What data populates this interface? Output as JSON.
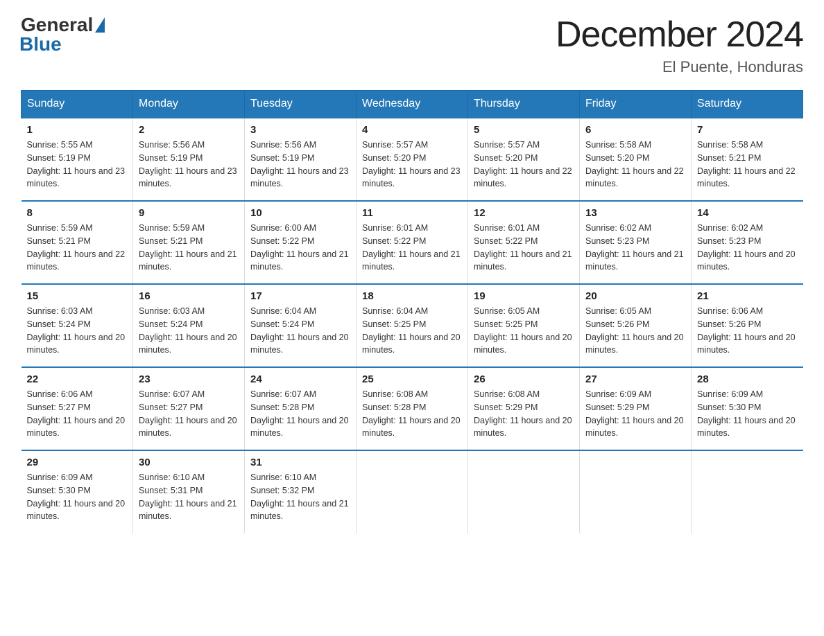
{
  "logo": {
    "general": "General",
    "blue": "Blue"
  },
  "title": "December 2024",
  "location": "El Puente, Honduras",
  "days_header": [
    "Sunday",
    "Monday",
    "Tuesday",
    "Wednesday",
    "Thursday",
    "Friday",
    "Saturday"
  ],
  "weeks": [
    [
      {
        "day": "1",
        "sunrise": "5:55 AM",
        "sunset": "5:19 PM",
        "daylight": "11 hours and 23 minutes."
      },
      {
        "day": "2",
        "sunrise": "5:56 AM",
        "sunset": "5:19 PM",
        "daylight": "11 hours and 23 minutes."
      },
      {
        "day": "3",
        "sunrise": "5:56 AM",
        "sunset": "5:19 PM",
        "daylight": "11 hours and 23 minutes."
      },
      {
        "day": "4",
        "sunrise": "5:57 AM",
        "sunset": "5:20 PM",
        "daylight": "11 hours and 23 minutes."
      },
      {
        "day": "5",
        "sunrise": "5:57 AM",
        "sunset": "5:20 PM",
        "daylight": "11 hours and 22 minutes."
      },
      {
        "day": "6",
        "sunrise": "5:58 AM",
        "sunset": "5:20 PM",
        "daylight": "11 hours and 22 minutes."
      },
      {
        "day": "7",
        "sunrise": "5:58 AM",
        "sunset": "5:21 PM",
        "daylight": "11 hours and 22 minutes."
      }
    ],
    [
      {
        "day": "8",
        "sunrise": "5:59 AM",
        "sunset": "5:21 PM",
        "daylight": "11 hours and 22 minutes."
      },
      {
        "day": "9",
        "sunrise": "5:59 AM",
        "sunset": "5:21 PM",
        "daylight": "11 hours and 21 minutes."
      },
      {
        "day": "10",
        "sunrise": "6:00 AM",
        "sunset": "5:22 PM",
        "daylight": "11 hours and 21 minutes."
      },
      {
        "day": "11",
        "sunrise": "6:01 AM",
        "sunset": "5:22 PM",
        "daylight": "11 hours and 21 minutes."
      },
      {
        "day": "12",
        "sunrise": "6:01 AM",
        "sunset": "5:22 PM",
        "daylight": "11 hours and 21 minutes."
      },
      {
        "day": "13",
        "sunrise": "6:02 AM",
        "sunset": "5:23 PM",
        "daylight": "11 hours and 21 minutes."
      },
      {
        "day": "14",
        "sunrise": "6:02 AM",
        "sunset": "5:23 PM",
        "daylight": "11 hours and 20 minutes."
      }
    ],
    [
      {
        "day": "15",
        "sunrise": "6:03 AM",
        "sunset": "5:24 PM",
        "daylight": "11 hours and 20 minutes."
      },
      {
        "day": "16",
        "sunrise": "6:03 AM",
        "sunset": "5:24 PM",
        "daylight": "11 hours and 20 minutes."
      },
      {
        "day": "17",
        "sunrise": "6:04 AM",
        "sunset": "5:24 PM",
        "daylight": "11 hours and 20 minutes."
      },
      {
        "day": "18",
        "sunrise": "6:04 AM",
        "sunset": "5:25 PM",
        "daylight": "11 hours and 20 minutes."
      },
      {
        "day": "19",
        "sunrise": "6:05 AM",
        "sunset": "5:25 PM",
        "daylight": "11 hours and 20 minutes."
      },
      {
        "day": "20",
        "sunrise": "6:05 AM",
        "sunset": "5:26 PM",
        "daylight": "11 hours and 20 minutes."
      },
      {
        "day": "21",
        "sunrise": "6:06 AM",
        "sunset": "5:26 PM",
        "daylight": "11 hours and 20 minutes."
      }
    ],
    [
      {
        "day": "22",
        "sunrise": "6:06 AM",
        "sunset": "5:27 PM",
        "daylight": "11 hours and 20 minutes."
      },
      {
        "day": "23",
        "sunrise": "6:07 AM",
        "sunset": "5:27 PM",
        "daylight": "11 hours and 20 minutes."
      },
      {
        "day": "24",
        "sunrise": "6:07 AM",
        "sunset": "5:28 PM",
        "daylight": "11 hours and 20 minutes."
      },
      {
        "day": "25",
        "sunrise": "6:08 AM",
        "sunset": "5:28 PM",
        "daylight": "11 hours and 20 minutes."
      },
      {
        "day": "26",
        "sunrise": "6:08 AM",
        "sunset": "5:29 PM",
        "daylight": "11 hours and 20 minutes."
      },
      {
        "day": "27",
        "sunrise": "6:09 AM",
        "sunset": "5:29 PM",
        "daylight": "11 hours and 20 minutes."
      },
      {
        "day": "28",
        "sunrise": "6:09 AM",
        "sunset": "5:30 PM",
        "daylight": "11 hours and 20 minutes."
      }
    ],
    [
      {
        "day": "29",
        "sunrise": "6:09 AM",
        "sunset": "5:30 PM",
        "daylight": "11 hours and 20 minutes."
      },
      {
        "day": "30",
        "sunrise": "6:10 AM",
        "sunset": "5:31 PM",
        "daylight": "11 hours and 21 minutes."
      },
      {
        "day": "31",
        "sunrise": "6:10 AM",
        "sunset": "5:32 PM",
        "daylight": "11 hours and 21 minutes."
      },
      null,
      null,
      null,
      null
    ]
  ]
}
